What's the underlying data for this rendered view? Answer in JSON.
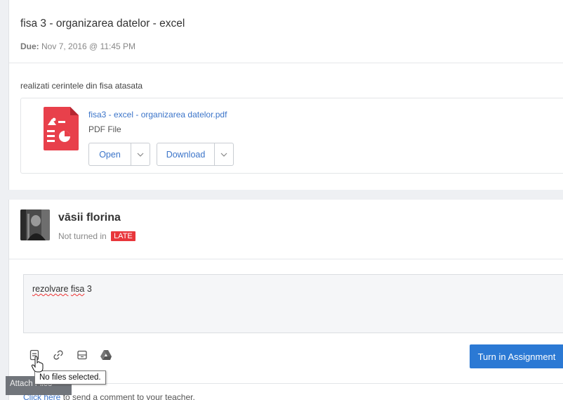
{
  "assignment": {
    "title": "fisa 3 - organizarea datelor - excel",
    "due_label": "Due:",
    "due_value": "Nov 7, 2016 @ 11:45 PM",
    "instructions": "realizati cerintele din fisa atasata"
  },
  "attachment": {
    "file_name": "fisa3 - excel - organizarea datelor.pdf",
    "file_type": "PDF File",
    "open_label": "Open",
    "download_label": "Download",
    "icon": "pdf-file-icon"
  },
  "submission": {
    "student_name": "vāsii florina",
    "status_text": "Not turned in",
    "late_badge": "LATE",
    "text_word1": "rezolvare",
    "text_word2": "fisa",
    "text_word3": "3",
    "turn_in_label": "Turn in Assignment",
    "comment_link": "Click here",
    "comment_rest": "to send a comment to your teacher."
  },
  "toolbar": {
    "icons": [
      "attach-file-icon",
      "link-icon",
      "onenote-icon",
      "google-drive-icon"
    ]
  },
  "tooltips": {
    "files_selected": "No files selected.",
    "attach_files": "Attach Files"
  },
  "colors": {
    "accent_blue": "#2b79d4",
    "link_blue": "#3b74c9",
    "late_red": "#e8363b",
    "pdf_red": "#e8404b"
  }
}
